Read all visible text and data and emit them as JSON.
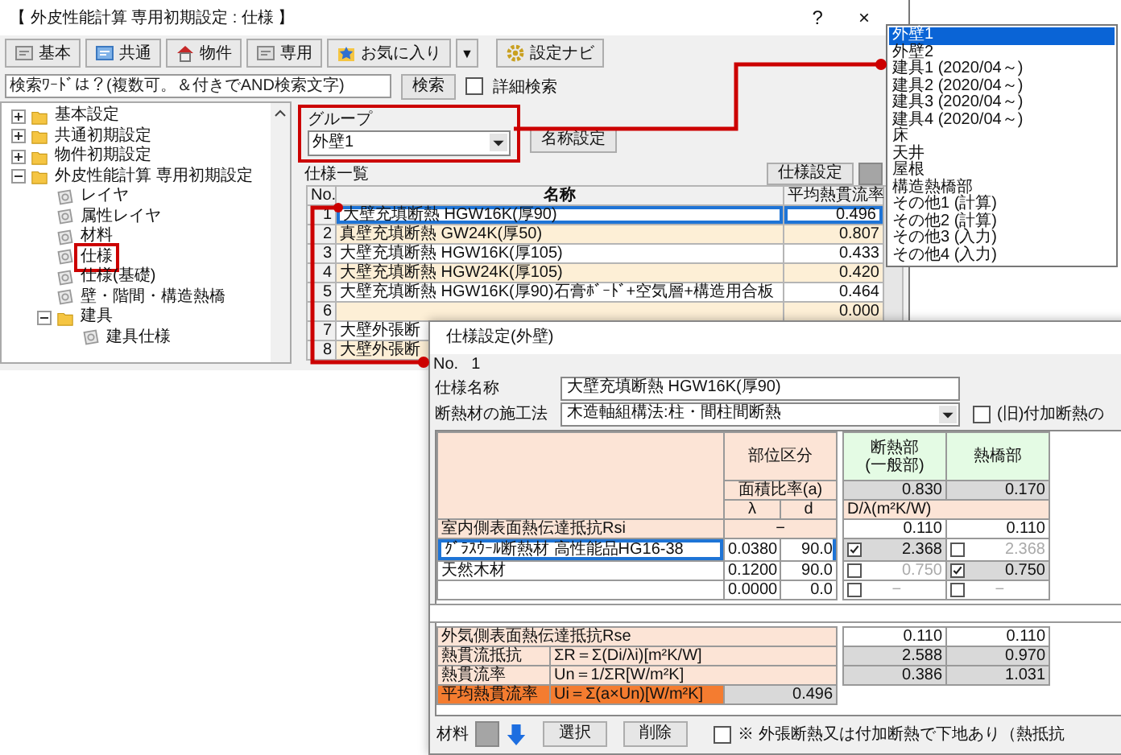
{
  "main_window": {
    "title": "【 外皮性能計算 専用初期設定 : 仕様 】",
    "help": "?",
    "close": "×"
  },
  "toolbar": [
    {
      "kind": "page",
      "label": "基本"
    },
    {
      "kind": "card",
      "label": "共通"
    },
    {
      "kind": "house",
      "label": "物件"
    },
    {
      "kind": "page",
      "label": "専用"
    },
    {
      "kind": "star",
      "label": "お気に入り"
    },
    {
      "kind": "dropdown",
      "label": "▼"
    },
    {
      "kind": "gear",
      "label": "設定ナビ"
    }
  ],
  "search": {
    "placeholder": "検索ﾜｰﾄﾞは？(複数可。＆付きでAND検索文字)",
    "button": "検索",
    "detail": {
      "label": "詳細検索",
      "checked": false
    }
  },
  "tree": [
    {
      "kind": "folder",
      "label": "基本設定",
      "expanded": false
    },
    {
      "kind": "folder",
      "label": "共通初期設定",
      "expanded": false
    },
    {
      "kind": "folder",
      "label": "物件初期設定",
      "expanded": false
    },
    {
      "kind": "folder",
      "label": "外皮性能計算 専用初期設定",
      "expanded": true,
      "children": [
        {
          "kind": "page",
          "label": "レイヤ",
          "framed": false
        },
        {
          "kind": "page",
          "label": "属性レイヤ",
          "framed": false
        },
        {
          "kind": "page",
          "label": "材料",
          "framed": false
        },
        {
          "kind": "page",
          "label": "仕様",
          "framed": true
        },
        {
          "kind": "page",
          "label": "仕様(基礎)",
          "framed": false
        },
        {
          "kind": "page",
          "label": "壁・階間・構造熱橋",
          "framed": false
        },
        {
          "kind": "folder",
          "label": "建具",
          "expanded": true,
          "children": [
            {
              "kind": "page",
              "label": "建具仕様",
              "framed": false
            }
          ]
        }
      ]
    }
  ],
  "group": {
    "label": "グループ",
    "value": "外壁1",
    "framed": true,
    "rename_button": "名称設定"
  },
  "spec_list": {
    "label": "仕様一覧",
    "settings_button": "仕様設定",
    "columns": [
      "No.",
      "名称",
      "平均熱貫流率"
    ],
    "rows": [
      {
        "no": "1",
        "name": "大壁充填断熱 HGW16K(厚90)",
        "value": "0.496",
        "selected": true
      },
      {
        "no": "2",
        "name": "真壁充填断熱 GW24K(厚50)",
        "value": "0.807",
        "selected": false
      },
      {
        "no": "3",
        "name": "大壁充填断熱 HGW16K(厚105)",
        "value": "0.433",
        "selected": false
      },
      {
        "no": "4",
        "name": "大壁充填断熱 HGW24K(厚105)",
        "value": "0.420",
        "selected": false
      },
      {
        "no": "5",
        "name": "大壁充填断熱 HGW16K(厚90)石膏ﾎﾞｰﾄﾞ+空気層+構造用合板",
        "value": "0.464",
        "selected": false
      },
      {
        "no": "6",
        "value": "0.000",
        "selected": false
      },
      {
        "no": "7",
        "name": "大壁外張断",
        "selected": false
      },
      {
        "no": "8",
        "name": "大壁外張断",
        "selected": false
      }
    ]
  },
  "group_options": [
    {
      "label": "外壁1",
      "selected": true
    },
    {
      "label": "外壁2",
      "selected": false
    },
    {
      "label": "建具1 (2020/04～)",
      "selected": false
    },
    {
      "label": "建具2 (2020/04～)",
      "selected": false
    },
    {
      "label": "建具3 (2020/04～)",
      "selected": false
    },
    {
      "label": "建具4 (2020/04～)",
      "selected": false
    },
    {
      "label": "床",
      "selected": false
    },
    {
      "label": "天井",
      "selected": false
    },
    {
      "label": "屋根",
      "selected": false
    },
    {
      "label": "構造熱橋部",
      "selected": false
    },
    {
      "label": "その他1 (計算)",
      "selected": false
    },
    {
      "label": "その他2 (計算)",
      "selected": false
    },
    {
      "label": "その他3 (入力)",
      "selected": false
    },
    {
      "label": "その他4 (入力)",
      "selected": false
    }
  ],
  "dialog": {
    "title": "仕様設定(外壁)",
    "no_label": "No.",
    "no_value": "1",
    "name_label": "仕様名称",
    "name_value": "大壁充填断熱 HGW16K(厚90)",
    "method_label": "断熱材の施工法",
    "method_value": "木造軸組構法:柱・間柱間断熱",
    "old_checkbox": {
      "label": "(旧)付加断熱の",
      "checked": false
    },
    "table": {
      "part_header": "部位区分",
      "insul_header": [
        "断熱部",
        "(一般部)"
      ],
      "bridge_header": "熱橋部",
      "area_label": "面積比率(a)",
      "area_insul": "0.830",
      "area_bridge": "0.170",
      "lambda_label": "λ",
      "d_label": "d",
      "dl_label": "D/λ(m²K/W)",
      "rows": [
        {
          "kind": "resistance",
          "name": "室内側表面熱伝達抵抗Rsi",
          "mid": "−",
          "insul": "0.110",
          "bridge": "0.110"
        },
        {
          "kind": "layer",
          "name": "ｸﾞﾗｽｳｰﾙ断熱材 高性能品HG16-38",
          "lambda": "0.0380",
          "d": "90.0",
          "insul_checked": true,
          "insul": "2.368",
          "bridge_checked": false,
          "bridge": "2.368",
          "selected": true
        },
        {
          "kind": "layer",
          "name": "天然木材",
          "lambda": "0.1200",
          "d": "90.0",
          "insul_checked": false,
          "insul": "0.750",
          "bridge_checked": true,
          "bridge": "0.750",
          "selected": false
        },
        {
          "kind": "layer",
          "lambda": "0.0000",
          "d": "0.0",
          "insul_checked": false,
          "insul": "−",
          "bridge_checked": false,
          "bridge": "−",
          "selected": false
        }
      ],
      "summary": [
        {
          "kind": "resistance",
          "name": "外気側表面熱伝達抵抗Rse",
          "insul": "0.110",
          "bridge": "0.110"
        },
        {
          "kind": "formula",
          "name": "熱貫流抵抗",
          "formula": "ΣR＝Σ(Di/λi)[m²K/W]",
          "insul": "2.588",
          "bridge": "0.970"
        },
        {
          "kind": "formula",
          "name": "熱貫流率",
          "formula": "Un＝1/ΣR[W/m²K]",
          "insul": "0.386",
          "bridge": "1.031"
        },
        {
          "kind": "total",
          "name": "平均熱貫流率",
          "formula": "Ui＝Σ(a×Un)[W/m²K]",
          "value": "0.496"
        }
      ]
    },
    "material_label": "材料",
    "select_button": "選択",
    "delete_button": "削除",
    "note_checkbox": {
      "label": "※ 外張断熱又は付加断熱で下地あり（熱抵抗",
      "checked": false
    }
  }
}
